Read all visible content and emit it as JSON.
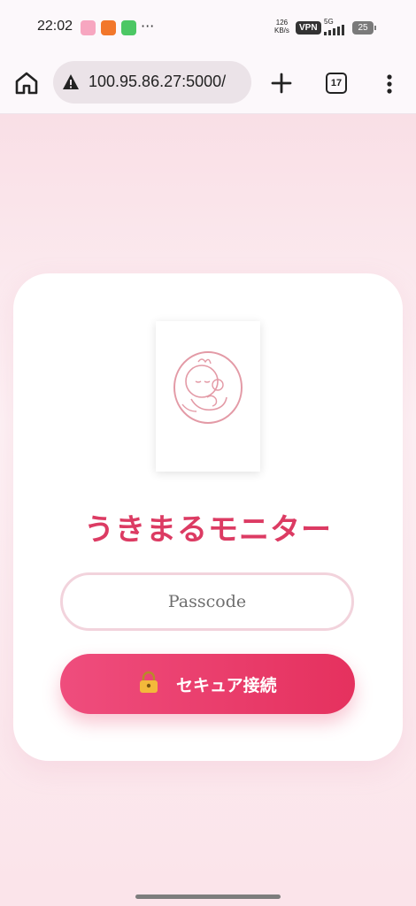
{
  "status_bar": {
    "time": "22:02",
    "notification_icons": [
      "photo-app-icon",
      "shopping-app-icon",
      "line-app-icon"
    ],
    "more": "···",
    "net_speed_value": "126",
    "net_speed_unit": "KB/s",
    "vpn": "VPN",
    "network": "5G",
    "battery": "25"
  },
  "browser": {
    "url": "100.95.86.27:5000/",
    "tab_count": "17",
    "icons": {
      "home": "home-icon",
      "security": "warning-icon",
      "new_tab": "plus-icon",
      "menu": "more-vertical-icon"
    }
  },
  "login": {
    "logo": "baby-logo-icon",
    "title": "うきまるモニター",
    "passcode_placeholder": "Passcode",
    "connect_label": "セキュア接続",
    "connect_icon": "lock-icon"
  },
  "colors": {
    "accent": "#dc3b63",
    "button_start": "#ef4d7d",
    "button_end": "#e5315e",
    "background": "#fbe4ea"
  }
}
